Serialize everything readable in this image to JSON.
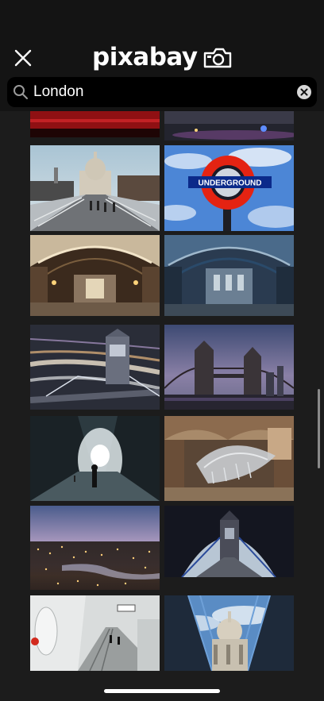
{
  "header": {
    "brand": "pixabay",
    "close_icon": "close-icon",
    "logo_icon": "camera-icon"
  },
  "search": {
    "value": "London",
    "search_icon": "search-icon",
    "clear_icon": "clear-icon"
  },
  "colors": {
    "background": "#1c1c1c",
    "header": "#141414",
    "search_field": "#000000",
    "text": "#ffffff"
  },
  "results": [
    {
      "subject": "red bus detail"
    },
    {
      "subject": "city at night"
    },
    {
      "subject": "St Paul's Cathedral from Millennium Bridge"
    },
    {
      "subject": "Underground roundel sign"
    },
    {
      "subject": "Natural History Museum hall"
    },
    {
      "subject": "Natural History Museum hall (blue)"
    },
    {
      "subject": "Tower Bridge light trails"
    },
    {
      "subject": "Tower Bridge at dusk"
    },
    {
      "subject": "London street silhouette"
    },
    {
      "subject": "Museum hall whale skeleton"
    },
    {
      "subject": "London skyline at sunset"
    },
    {
      "subject": "Tower Bridge walkway"
    },
    {
      "subject": "Underground station platform"
    },
    {
      "subject": "St Paul's Cathedral reflection"
    }
  ]
}
